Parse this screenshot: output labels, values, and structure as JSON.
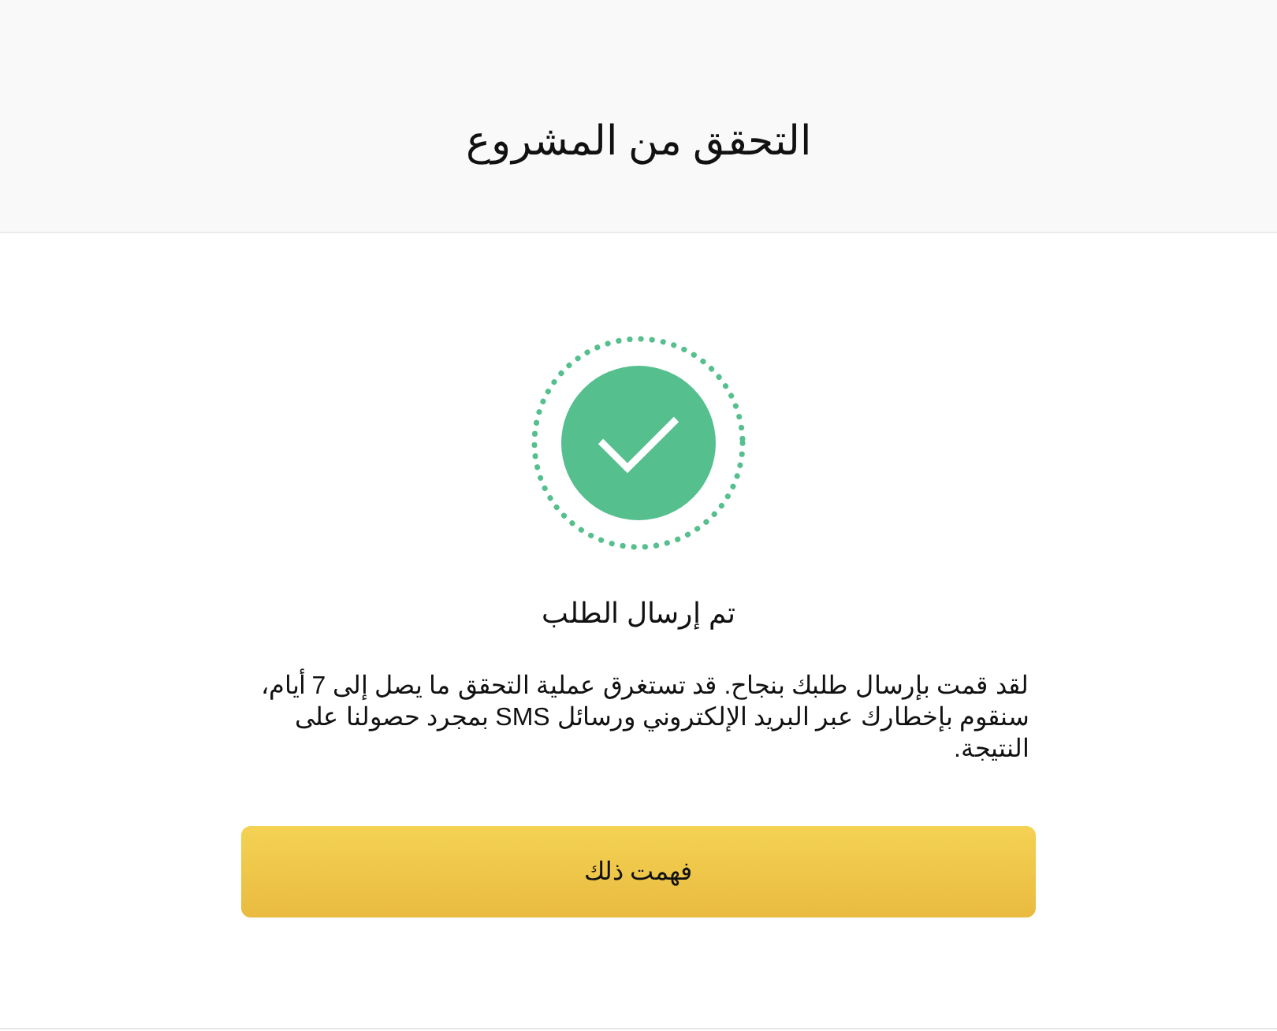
{
  "header": {
    "title": "التحقق من المشروع"
  },
  "status": {
    "kind": "success",
    "heading": "تم إرسال الطلب",
    "message": "لقد قمت بإرسال طلبك بنجاح. قد تستغرق عملية التحقق ما يصل إلى 7 أيام، سنقوم بإخطارك عبر البريد الإلكتروني ورسائل SMS بمجرد حصولنا على النتيجة."
  },
  "button": {
    "label": "فهمت ذلك"
  }
}
